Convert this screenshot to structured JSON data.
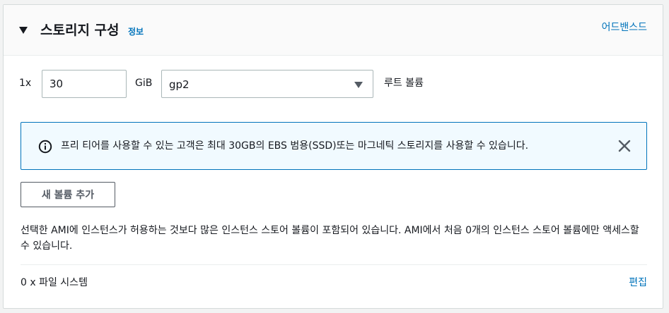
{
  "section": {
    "title": "스토리지 구성",
    "info_link": "정보",
    "advanced_link": "어드밴스드"
  },
  "volume": {
    "quantity": "1x",
    "size_value": "30",
    "unit": "GiB",
    "type_selected": "gp2",
    "label": "루트 볼륨"
  },
  "alert": {
    "text": "프리 티어를 사용할 수 있는 고객은 최대 30GB의 EBS 범용(SSD)또는 마그네틱 스토리지를 사용할 수 있습니다.",
    "icon": "info-icon",
    "close_icon": "close-icon",
    "accent_color": "#0073bb"
  },
  "actions": {
    "add_volume_label": "새 볼륨 추가"
  },
  "description": "선택한 AMI에 인스턴스가 허용하는 것보다 많은 인스턴스 스토어 볼륨이 포함되어 있습니다. AMI에서 처음 0개의 인스턴스 스토어 볼륨에만 액세스할 수 있습니다.",
  "filesystems": {
    "label": "0 x 파일 시스템",
    "edit_link": "편집"
  },
  "colors": {
    "link": "#0073bb",
    "text": "#16191f"
  }
}
